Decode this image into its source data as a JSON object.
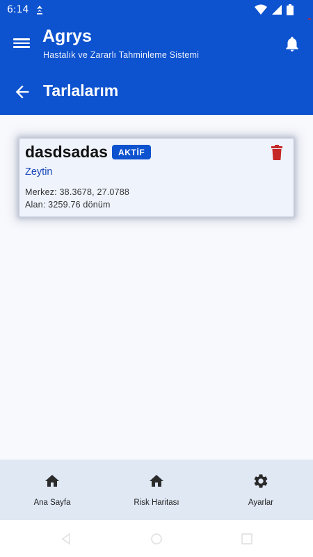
{
  "status_bar": {
    "time": "6:14"
  },
  "app_bar": {
    "title": "Agrys",
    "subtitle": "Hastalık ve Zararlı Tahminleme Sistemi",
    "page_title": "Tarlalarım"
  },
  "fields": [
    {
      "name": "dasdsadas",
      "status": "AKTİF",
      "crop": "Zeytin",
      "center": "Merkez: 38.3678, 27.0788",
      "area": "Alan: 3259.76 dönüm"
    }
  ],
  "bottom_nav": [
    {
      "label": "Ana Sayfa",
      "icon": "home-icon"
    },
    {
      "label": "Risk Haritası",
      "icon": "home-icon"
    },
    {
      "label": "Ayarlar",
      "icon": "gear-icon"
    }
  ],
  "colors": {
    "primary": "#0d52cf",
    "delete": "#c62828",
    "crop_text": "#1a47b8",
    "nav_bg": "#e0e8f4",
    "card_bg": "#eef3fc"
  }
}
